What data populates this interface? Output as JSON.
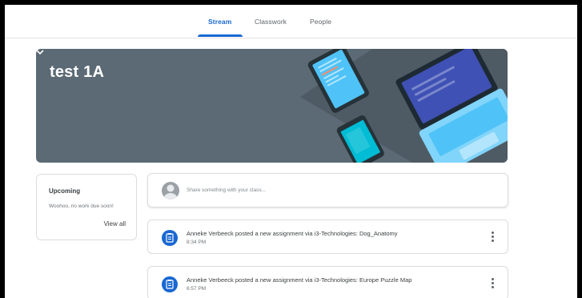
{
  "tabs": [
    {
      "label": "Stream",
      "active": true
    },
    {
      "label": "Classwork",
      "active": false
    },
    {
      "label": "People",
      "active": false
    }
  ],
  "banner": {
    "title": "test 1A",
    "color": "#5b6a74"
  },
  "upcoming": {
    "title": "Upcoming",
    "text": "Woohoo, no work due soon!",
    "link": "View all"
  },
  "share": {
    "placeholder": "Share something with your class..."
  },
  "posts": [
    {
      "title": "Anneke Verbeeck posted a new assignment via i3-Technologies: Dog_Anatomy",
      "time": "8:34 PM"
    },
    {
      "title": "Anneke Verbeeck posted a new assignment via i3-Technologies: Europe Puzzle Map",
      "time": "6:57 PM"
    }
  ],
  "colors": {
    "accent": "#1967d2"
  }
}
